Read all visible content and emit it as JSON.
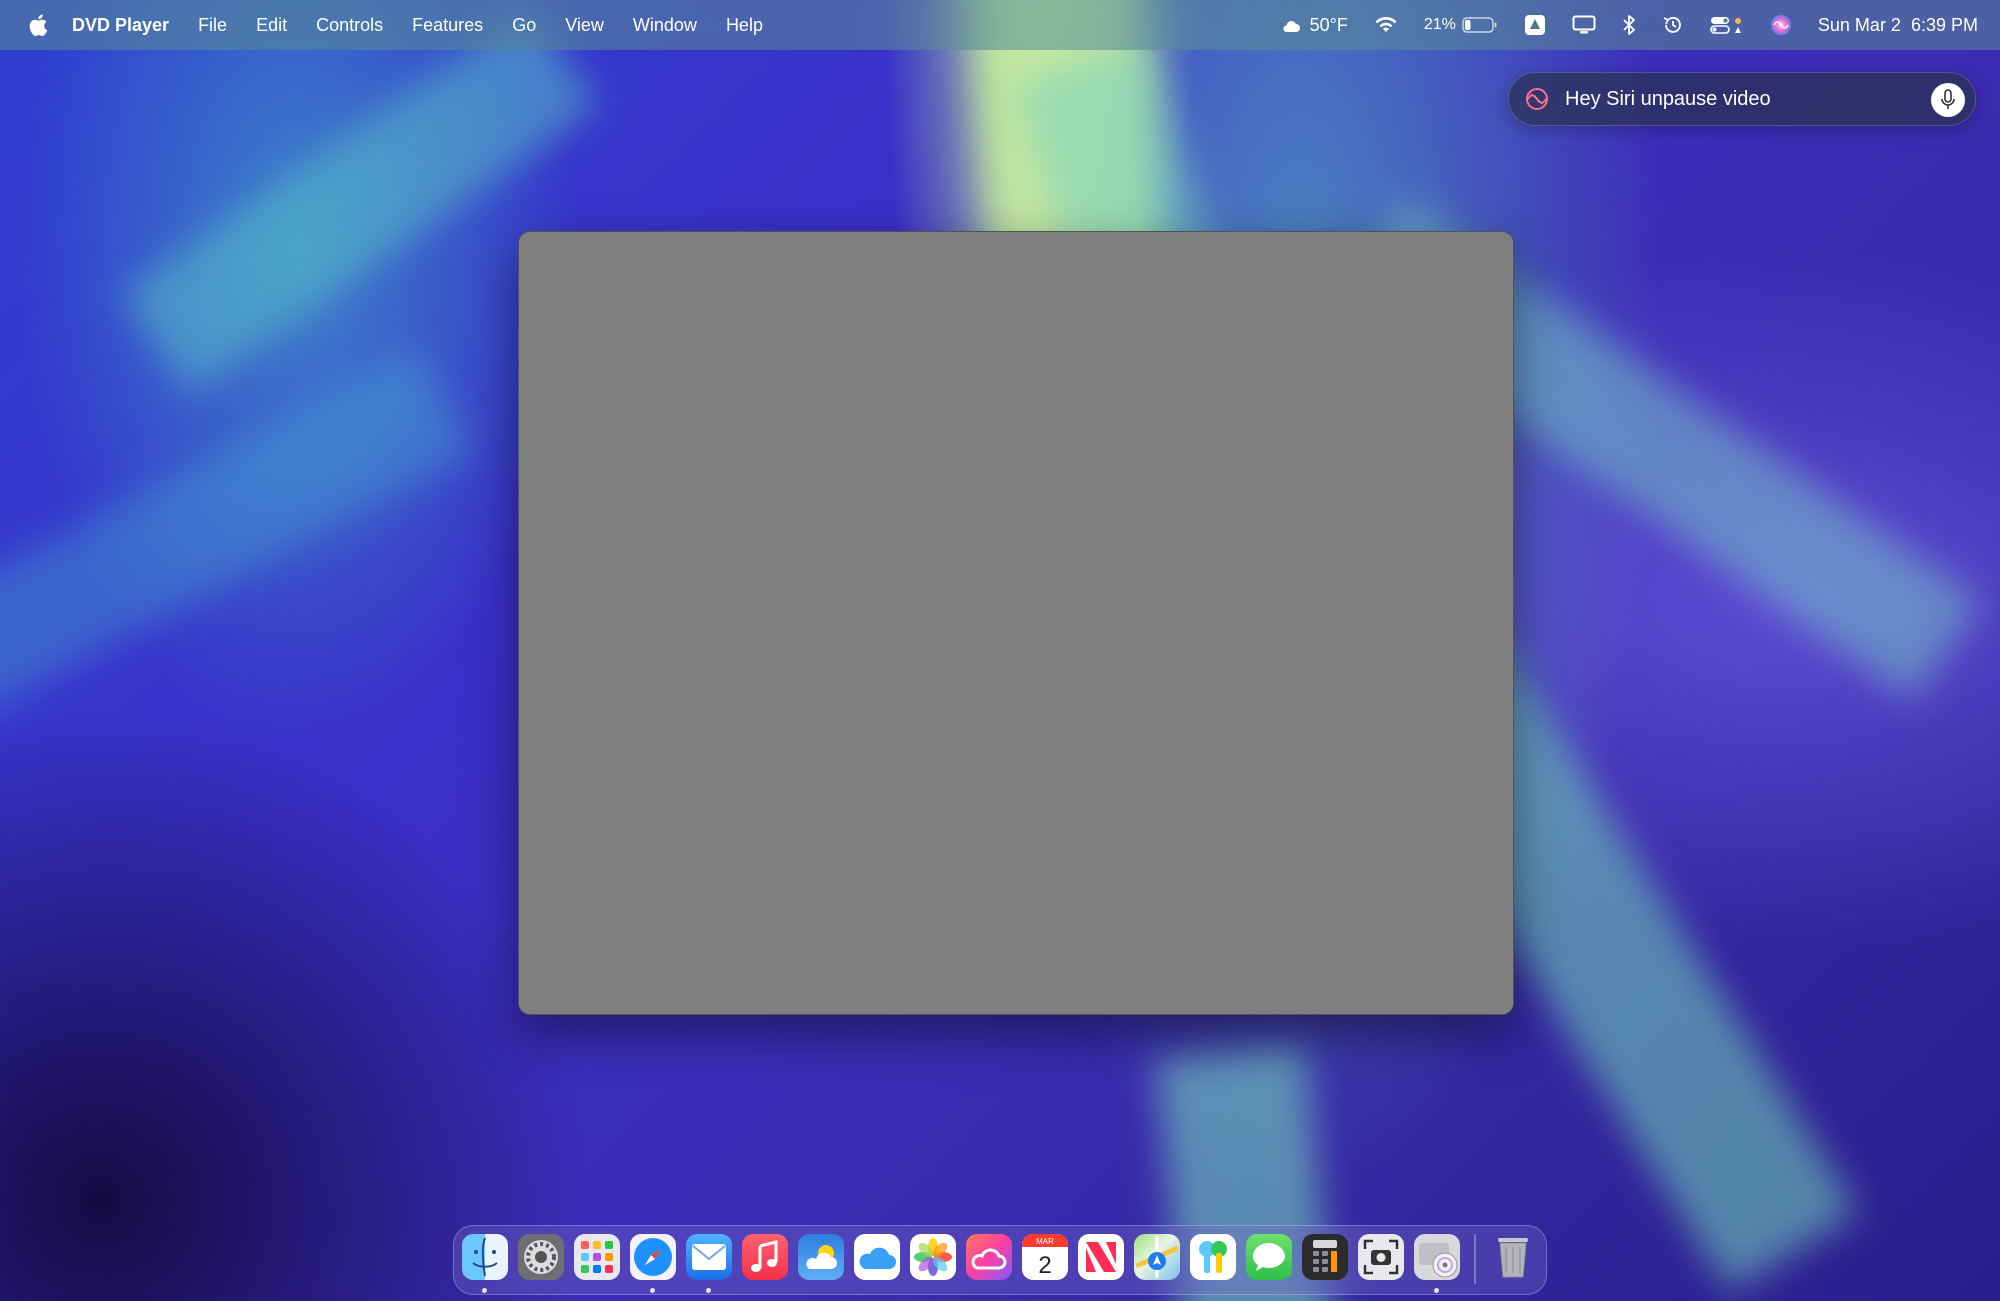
{
  "menubar": {
    "app_name": "DVD Player",
    "menus": [
      "File",
      "Edit",
      "Controls",
      "Features",
      "Go",
      "View",
      "Window",
      "Help"
    ],
    "weather": "50°F",
    "battery_percent": "21%",
    "battery_level": 0.21,
    "date": "Sun Mar 2",
    "time": "6:39 PM"
  },
  "siri": {
    "query": "Hey Siri unpause video"
  },
  "dock": {
    "items": [
      {
        "name": "Finder",
        "icon": "finder-icon"
      },
      {
        "name": "System Settings",
        "icon": "settings-icon"
      },
      {
        "name": "Launchpad",
        "icon": "launchpad-icon"
      },
      {
        "name": "Safari",
        "icon": "safari-icon"
      },
      {
        "name": "Mail",
        "icon": "mail-icon"
      },
      {
        "name": "Music",
        "icon": "music-icon"
      },
      {
        "name": "Weather",
        "icon": "weather-icon"
      },
      {
        "name": "iCloud",
        "icon": "icloud-icon"
      },
      {
        "name": "Photos",
        "icon": "photos-icon"
      },
      {
        "name": "Creative Cloud",
        "icon": "creative-cloud-icon"
      },
      {
        "name": "Calendar",
        "icon": "calendar-icon",
        "month": "MAR",
        "day": "2"
      },
      {
        "name": "News",
        "icon": "news-icon"
      },
      {
        "name": "Maps",
        "icon": "maps-icon"
      },
      {
        "name": "Passwords",
        "icon": "passwords-icon"
      },
      {
        "name": "Messages",
        "icon": "messages-icon"
      },
      {
        "name": "Calculator",
        "icon": "calculator-icon"
      },
      {
        "name": "Screenshot",
        "icon": "screenshot-icon"
      },
      {
        "name": "DVD Player",
        "icon": "dvd-player-icon"
      },
      {
        "name": "Trash",
        "icon": "trash-icon"
      }
    ]
  }
}
